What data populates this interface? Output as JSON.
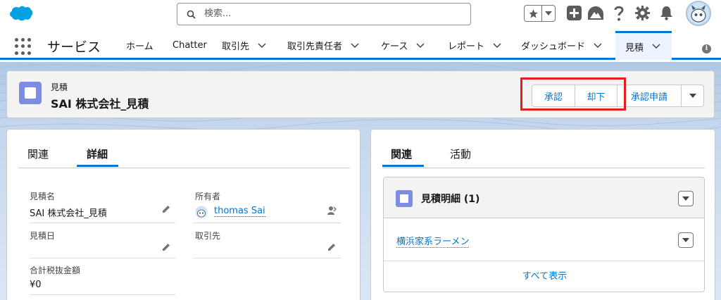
{
  "header": {
    "search_placeholder": "検索...",
    "icons": [
      "salesforce-cloud-logo",
      "star-icon",
      "chevron-down-icon",
      "add-icon",
      "trailhead-icon",
      "help-icon",
      "gear-icon",
      "bell-icon",
      "avatar"
    ]
  },
  "nav": {
    "app_name": "サービス",
    "tabs": [
      {
        "label": "ホーム"
      },
      {
        "label": "Chatter"
      },
      {
        "label": "取引先"
      },
      {
        "label": "取引先責任者"
      },
      {
        "label": "ケース"
      },
      {
        "label": "レポート"
      },
      {
        "label": "ダッシュボード"
      },
      {
        "label": "見積",
        "active": true
      }
    ]
  },
  "record": {
    "object_label": "見積",
    "name": "SAI 株式会社_見積",
    "buttons": {
      "approve": "承認",
      "reject": "却下",
      "submit": "承認申請"
    }
  },
  "left_card": {
    "tabs": {
      "related": "関連",
      "details": "詳細"
    },
    "fields": {
      "quote_name_label": "見積名",
      "quote_name_value": "SAI 株式会社_見積",
      "owner_label": "所有者",
      "owner_value": "thomas Sai",
      "quote_date_label": "見積日",
      "account_label": "取引先",
      "total_label": "合計税抜金額",
      "total_value": "¥0"
    }
  },
  "right_card": {
    "tabs": {
      "related": "関連",
      "activity": "活動"
    },
    "related_list": {
      "title": "見積明細 (1)",
      "item": "横浜家系ラーメン",
      "view_all": "すべて表示"
    }
  },
  "colors": {
    "brand_blue": "#0176d3",
    "highlight_red": "#e41d1d",
    "object_icon": "#7f8de1"
  }
}
